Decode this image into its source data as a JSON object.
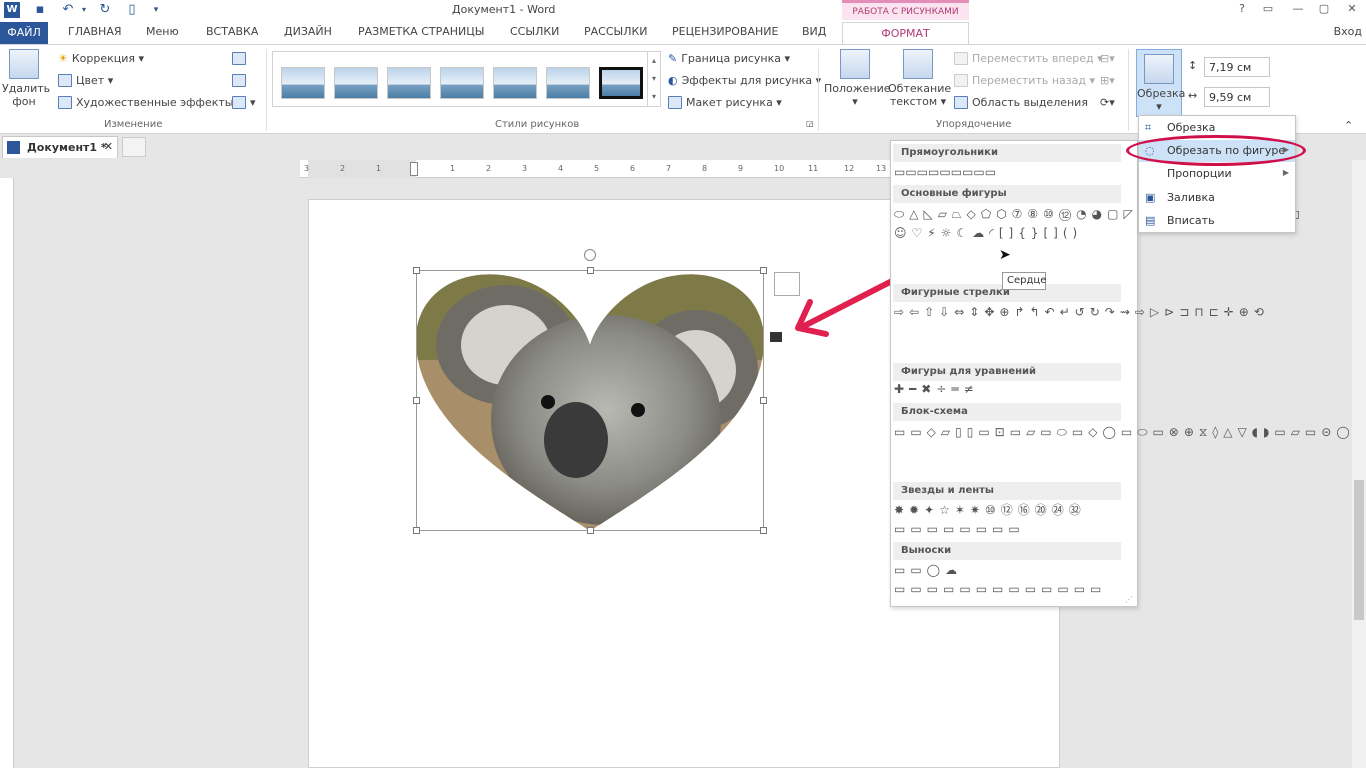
{
  "title_bar": {
    "doc_title": "Документ1 - Word",
    "context_group": "РАБОТА С РИСУНКАМИ",
    "window_buttons": [
      "?",
      "▭",
      "—",
      "▢",
      "✕"
    ]
  },
  "tabs": {
    "file": "ФАЙЛ",
    "items": [
      "ГЛАВНАЯ",
      "Меню",
      "ВСТАВКА",
      "ДИЗАЙН",
      "РАЗМЕТКА СТРАНИЦЫ",
      "ССЫЛКИ",
      "РАССЫЛКИ",
      "РЕЦЕНЗИРОВАНИЕ",
      "ВИД"
    ],
    "format": "ФОРМАТ",
    "signin": "Вход"
  },
  "ribbon": {
    "remove_bg": "Удалить фон",
    "correction": "Коррекция ▾",
    "color": "Цвет ▾",
    "art_effects": "Художественные эффекты ▾",
    "group_change": "Изменение",
    "group_styles": "Стили рисунков",
    "picture_border": "Граница рисунка ▾",
    "picture_effects": "Эффекты для рисунка ▾",
    "picture_layout": "Макет рисунка ▾",
    "position": "Положение",
    "wrap_text_1": "Обтекание",
    "wrap_text_2": "текстом ▾",
    "bring_forward": "Переместить вперед ▾",
    "send_backward": "Переместить назад ▾",
    "selection_pane": "Область выделения",
    "group_arrange": "Упорядочение",
    "crop": "Обрезка",
    "height_value": "7,19 см",
    "width_value": "9,59 см"
  },
  "doc_tab": {
    "name": "Документ1 *"
  },
  "ruler": {
    "labels": [
      "3",
      "2",
      "1",
      "1",
      "2",
      "3",
      "4",
      "5",
      "6",
      "7",
      "8",
      "9",
      "10",
      "11",
      "12",
      "13"
    ]
  },
  "crop_menu": {
    "items": [
      {
        "label": "Обрезка"
      },
      {
        "label": "Обрезать по фигуре"
      },
      {
        "label": "Пропорции"
      },
      {
        "label": "Заливка"
      },
      {
        "label": "Вписать"
      }
    ]
  },
  "shapes_gallery": {
    "sections": [
      {
        "title": "Прямоугольники",
        "shapes": "▭▭▭▭▭▭▭▭▭"
      },
      {
        "title": "Основные фигуры",
        "shapes": "⬭△◺▱⏢◇⬠⬡⑦⑧⑩⑫◔◕▢◸◿⌒◠▱▭◧◫◎⊘⌓◻☺♡⚡☼☾☁◜[]{}[]()"
      },
      {
        "title": "Фигурные стрелки",
        "shapes": "⇨⇦⇧⇩⇔⇕✥⊕↱↰↶↵↺↻↷⇝⇨▷⊳⊐⊓⊏✛⊕⟲"
      },
      {
        "title": "Фигуры для уравнений",
        "shapes": "✚━✖÷═≠"
      },
      {
        "title": "Блок-схема",
        "shapes": "▭▭◇▱▯▯▭⊡▭▱▭⬭▭◇◯▭⬭▭⊗⊕⧖◊△▽◖◗▭▱▭⊝◯"
      },
      {
        "title": "Звезды и ленты",
        "shapes": "✸✹✦☆✶✷⑩⑫⑯⑳㉔㉜▭▭▭▭▭▭▭▭"
      },
      {
        "title": "Выноски",
        "shapes": "▭▭◯☁▭▭▭▭▭▭▭▭▭▭▭▭▭"
      }
    ],
    "tooltip": "Сердце"
  },
  "colors": {
    "accent": "#2b579a",
    "context": "#b03a77",
    "highlight": "#cde2f7",
    "annotation": "#d0104a"
  }
}
